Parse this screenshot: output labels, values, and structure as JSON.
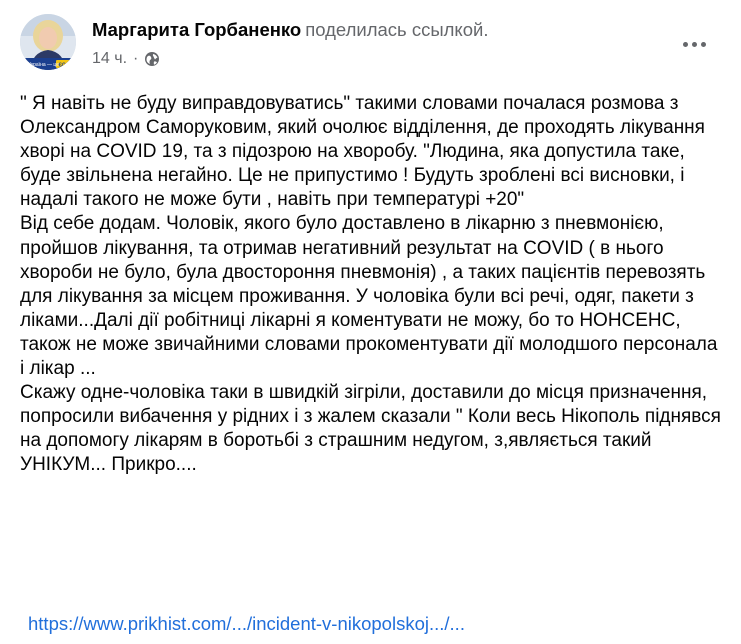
{
  "author": {
    "name": "Маргарита Горбаненко",
    "action": "поделилась ссылкой.",
    "avatar_caption": "Україна — це ",
    "avatar_badge": "ЄС"
  },
  "meta": {
    "time": "14 ч.",
    "separator": "·",
    "privacy_icon": "globe-icon"
  },
  "menu": {
    "icon": "more-options-icon"
  },
  "post": {
    "paragraphs": [
      "\" Я навіть не буду виправдовуватись\" такими словами почалася розмова з Олександром Саморуковим, який очолює відділення, де проходять лікування хворі на COVID 19, та з підозрою на хворобу. \"Людина, яка допустила таке, буде звільнена негайно. Це не припустимо ! Будуть зроблені всі висновки, і надалі такого не може бути , навіть при температурі +20\"",
      "Від себе додам. Чоловік, якого було доставлено в лікарню з пневмонією, пройшов лікування, та отримав негативний результат на COVID ( в нього хвороби не було, була двостороння пневмонія) , а таких пацієнтів перевозять для лікування за місцем проживання. У чоловіка були всі речі, одяг, пакети з ліками...Далі дії робітниці лікарні я коментувати не можу, бо то НОНСЕНС, також не може звичайними словами прокоментувати дії молодшого персонала і лікар ...",
      "Скажу одне-чоловіка таки в швидкій зігріли, доставили до місця призначення, попросили вибачення у рідних і з жалем сказали \" Коли весь Нікополь піднявся на допомогу лікарям в боротьбі з страшним недугом, з,являється такий УНІКУМ... Прикро...."
    ],
    "link": "https://www.prikhist.com/.../incident-v-nikopolskoj.../..."
  },
  "colors": {
    "text": "#050505",
    "secondary": "#65676b",
    "link": "#216fdb"
  }
}
